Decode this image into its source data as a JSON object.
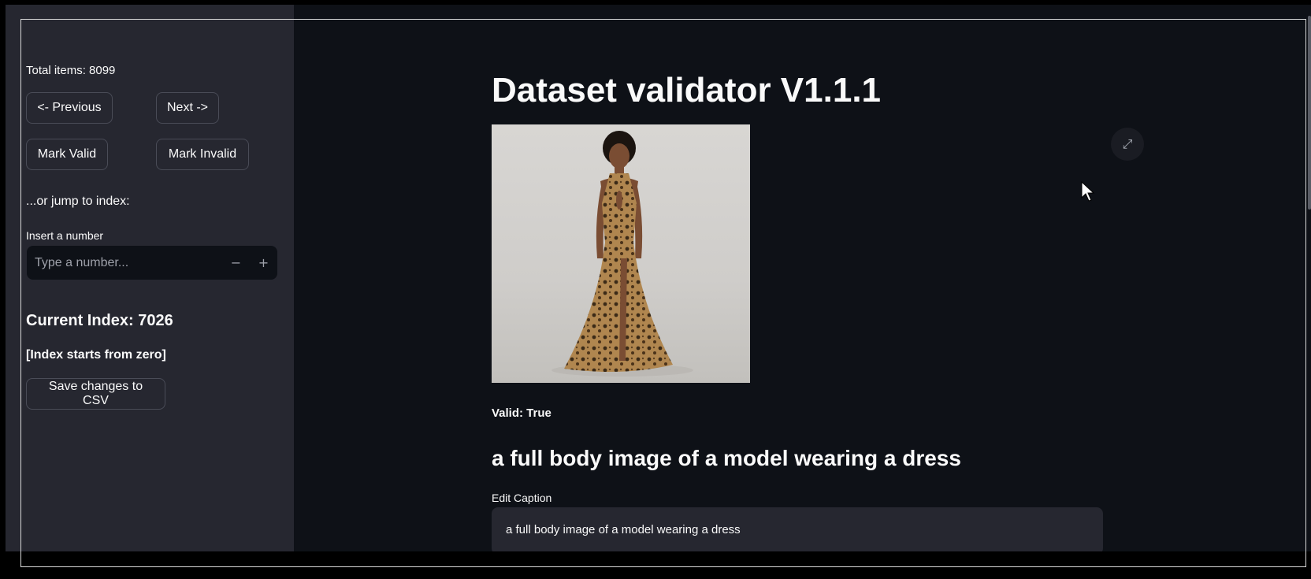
{
  "sidebar": {
    "total_items": "Total items: 8099",
    "prev_label": "<- Previous",
    "next_label": "Next ->",
    "mark_valid_label": "Mark Valid",
    "mark_invalid_label": "Mark Invalid",
    "jump_text": "...or jump to index:",
    "insert_label": "Insert a number",
    "number_placeholder": "Type a number...",
    "minus_label": "−",
    "plus_label": "+",
    "current_index": "Current Index: 7026",
    "index_note": "[Index starts from zero]",
    "save_label": "Save changes to CSV"
  },
  "main": {
    "title": "Dataset validator V1.1.1",
    "valid_status": "Valid: True",
    "caption_heading": "a full body image of a model wearing a dress",
    "edit_caption_label": "Edit Caption",
    "caption_value": "a full body image of a model wearing a dress"
  },
  "icons": {
    "expand": "expand-icon",
    "cursor": "mouse-pointer-icon"
  },
  "colors": {
    "background": "#0e1117",
    "sidebar": "#262730",
    "text": "#fafafa"
  }
}
